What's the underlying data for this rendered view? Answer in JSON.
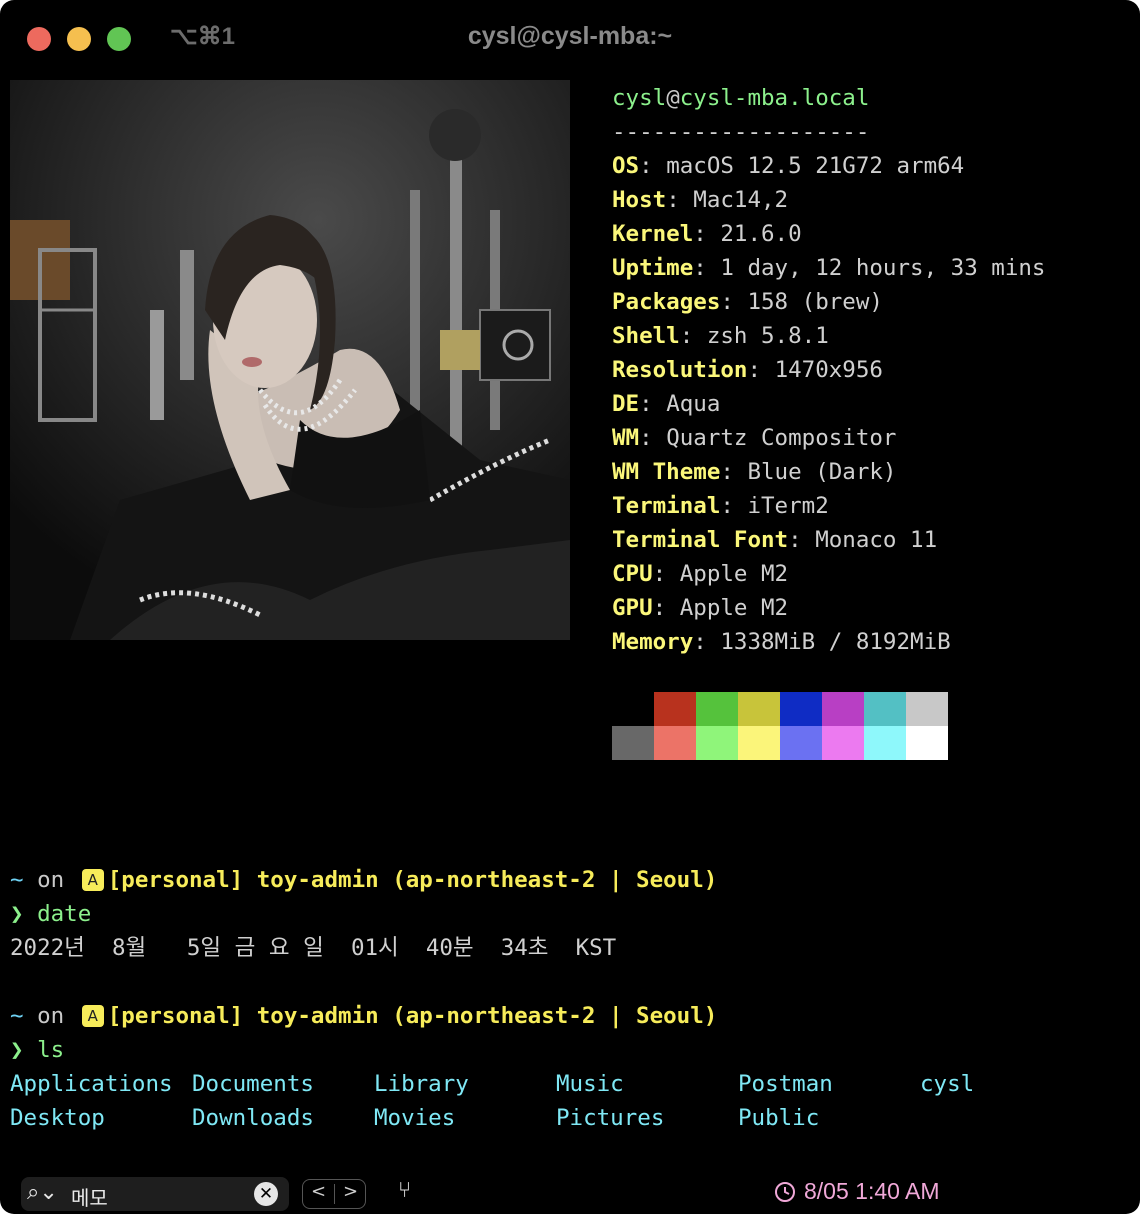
{
  "window": {
    "shortcut": "⌥⌘1",
    "title": "cysl@cysl-mba:~"
  },
  "neofetch": {
    "user": "cysl",
    "at": "@",
    "host": "cysl-mba.local",
    "separator": "-------------------",
    "info": [
      {
        "key": "OS",
        "value": "macOS 12.5 21G72 arm64"
      },
      {
        "key": "Host",
        "value": "Mac14,2"
      },
      {
        "key": "Kernel",
        "value": "21.6.0"
      },
      {
        "key": "Uptime",
        "value": "1 day, 12 hours, 33 mins"
      },
      {
        "key": "Packages",
        "value": "158 (brew)"
      },
      {
        "key": "Shell",
        "value": "zsh 5.8.1"
      },
      {
        "key": "Resolution",
        "value": "1470x956"
      },
      {
        "key": "DE",
        "value": "Aqua"
      },
      {
        "key": "WM",
        "value": "Quartz Compositor"
      },
      {
        "key": "WM Theme",
        "value": "Blue (Dark)"
      },
      {
        "key": "Terminal",
        "value": "iTerm2"
      },
      {
        "key": "Terminal Font",
        "value": "Monaco 11"
      },
      {
        "key": "CPU",
        "value": "Apple M2"
      },
      {
        "key": "GPU",
        "value": "Apple M2"
      },
      {
        "key": "Memory",
        "value": "1338MiB / 8192MiB"
      }
    ],
    "palette_top": [
      "#000000",
      "#b8321e",
      "#55c23c",
      "#c8c43a",
      "#0f2cc4",
      "#b83fc4",
      "#53c0c4",
      "#c8c8c8"
    ],
    "palette_bottom": [
      "#686868",
      "#ec7367",
      "#8ff57a",
      "#fbf57a",
      "#6b71f2",
      "#ec7af0",
      "#8ef8fb",
      "#ffffff"
    ]
  },
  "prompts": [
    {
      "tilde": "~",
      "on": "on",
      "badge": "A",
      "aws": "[personal] toy-admin (ap-northeast-2 | Seoul)",
      "chevron": "❯",
      "command": "date",
      "output": "2022년  8월   5일 금 요 일  01시  40분  34초  KST"
    },
    {
      "tilde": "~",
      "on": "on",
      "badge": "A",
      "aws": "[personal] toy-admin (ap-northeast-2 | Seoul)",
      "chevron": "❯",
      "command": "ls"
    }
  ],
  "ls_output": [
    "Applications",
    "Documents",
    "Library",
    "Music",
    "Postman",
    "cysl",
    "Desktop",
    "Downloads",
    "Movies",
    "Pictures",
    "Public"
  ],
  "statusbar": {
    "search_icon": "search-icon",
    "search_value": "메모",
    "prev_label": "<",
    "next_label": ">",
    "branch_glyph": "⑂",
    "clock_icon": "clock-icon",
    "datetime": "8/05 1:40 AM"
  }
}
